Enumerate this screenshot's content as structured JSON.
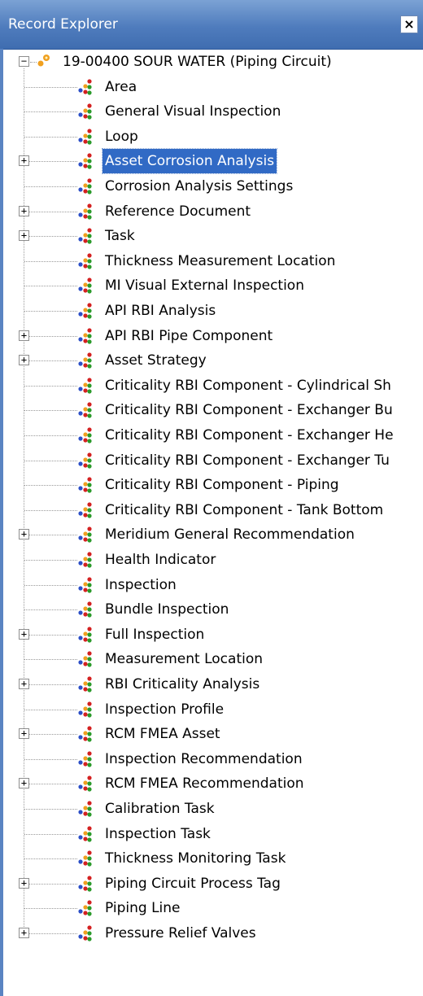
{
  "panel": {
    "title": "Record Explorer",
    "close_label": "×"
  },
  "tree": {
    "root": {
      "label": "19-00400 SOUR WATER (Piping Circuit)",
      "expander": "−",
      "icon": "piping-circuit-record-icon"
    },
    "children": [
      {
        "label": "Area",
        "expandable": false
      },
      {
        "label": "General Visual Inspection",
        "expandable": false
      },
      {
        "label": "Loop",
        "expandable": false
      },
      {
        "label": "Asset Corrosion Analysis",
        "expandable": true,
        "selected": true
      },
      {
        "label": "Corrosion Analysis Settings",
        "expandable": false
      },
      {
        "label": "Reference Document",
        "expandable": true
      },
      {
        "label": "Task",
        "expandable": true
      },
      {
        "label": "Thickness Measurement Location",
        "expandable": false
      },
      {
        "label": "MI Visual External Inspection",
        "expandable": false
      },
      {
        "label": "API RBI Analysis",
        "expandable": false
      },
      {
        "label": "API RBI Pipe Component",
        "expandable": true
      },
      {
        "label": "Asset Strategy",
        "expandable": true
      },
      {
        "label": "Criticality RBI Component - Cylindrical Sh",
        "expandable": false
      },
      {
        "label": "Criticality RBI Component - Exchanger Bu",
        "expandable": false
      },
      {
        "label": "Criticality RBI Component - Exchanger He",
        "expandable": false
      },
      {
        "label": "Criticality RBI Component - Exchanger Tu",
        "expandable": false
      },
      {
        "label": "Criticality RBI Component - Piping",
        "expandable": false
      },
      {
        "label": "Criticality RBI Component - Tank Bottom",
        "expandable": false
      },
      {
        "label": "Meridium General Recommendation",
        "expandable": true
      },
      {
        "label": "Health Indicator",
        "expandable": false
      },
      {
        "label": "Inspection",
        "expandable": false
      },
      {
        "label": "Bundle Inspection",
        "expandable": false
      },
      {
        "label": "Full Inspection",
        "expandable": true
      },
      {
        "label": "Measurement Location",
        "expandable": false
      },
      {
        "label": "RBI Criticality Analysis",
        "expandable": true
      },
      {
        "label": "Inspection Profile",
        "expandable": false
      },
      {
        "label": "RCM FMEA Asset",
        "expandable": true
      },
      {
        "label": "Inspection Recommendation",
        "expandable": false
      },
      {
        "label": "RCM FMEA Recommendation",
        "expandable": true
      },
      {
        "label": "Calibration Task",
        "expandable": false
      },
      {
        "label": "Inspection Task",
        "expandable": false
      },
      {
        "label": "Thickness Monitoring Task",
        "expandable": false
      },
      {
        "label": "Piping Circuit Process Tag",
        "expandable": true
      },
      {
        "label": "Piping Line",
        "expandable": false
      },
      {
        "label": "Pressure Relief Valves",
        "expandable": true
      }
    ],
    "expand_glyph": "+",
    "child_icon": "record-family-icon",
    "colors": {
      "selection": "#316ac5",
      "titlebar": "#4f7cbd",
      "icon_red": "#d42020",
      "icon_green": "#2a9a2a",
      "icon_blue": "#2b4fc7",
      "icon_orange": "#f0a020"
    }
  }
}
